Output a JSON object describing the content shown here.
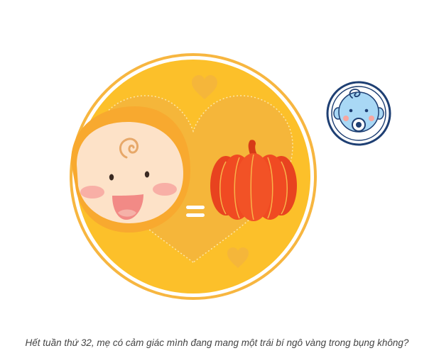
{
  "caption": "Hết tuần thứ 32, mẹ có cảm giác mình đang mang một trái bí ngô vàng trong bụng không?",
  "illustration": {
    "left_item": "baby-face",
    "operator": "=",
    "right_item": "pumpkin",
    "badge": "baby-pacifier-icon"
  },
  "colors": {
    "outer_ring": "#f7b640",
    "circle_fill": "#fcc02a",
    "heart": "#f5b63a",
    "baby_hood": "#f8a92f",
    "baby_face": "#fde2c8",
    "cheeks": "#f7a6a0",
    "mouth": "#f28a86",
    "pumpkin": "#f04a22",
    "pumpkin_stem": "#d63a17",
    "badge_ring": "#1e3f73",
    "badge_face": "#a9d8f5"
  }
}
